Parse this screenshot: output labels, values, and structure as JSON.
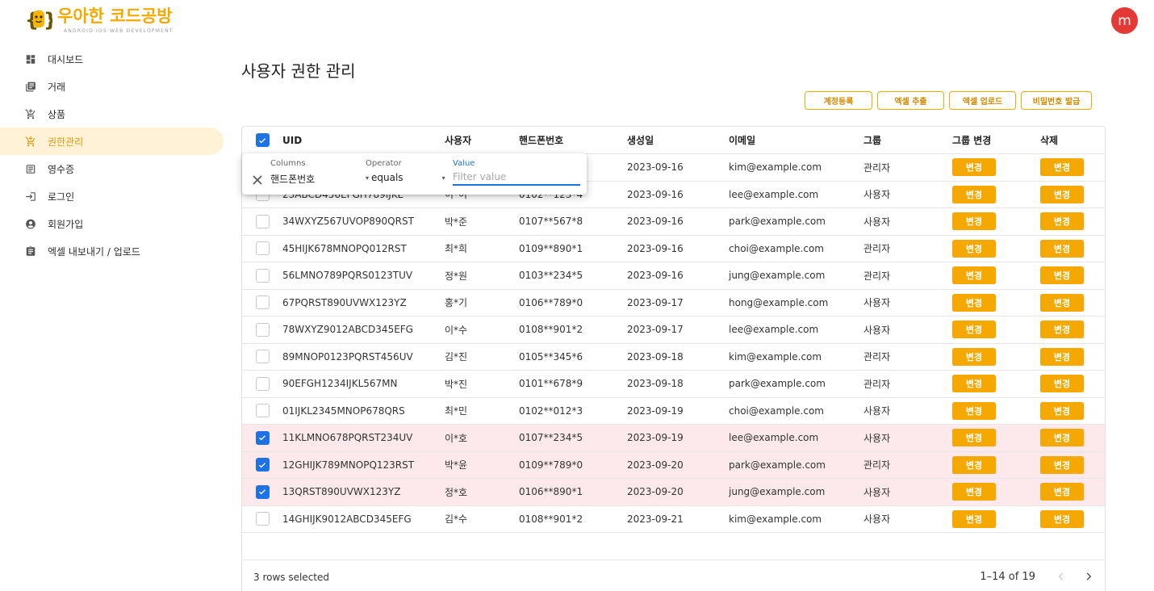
{
  "brand": {
    "title": "우아한 코드공방",
    "subtitle": "ANDROID·IOS·WEB DEVELOPMENT"
  },
  "colors": {
    "accent": "#f5a800",
    "selection": "#1e72e3",
    "selected_row": "#fde9ec",
    "avatar": "#e53935"
  },
  "sidebar": {
    "items": [
      {
        "label": "대시보드",
        "icon": "dashboard-icon"
      },
      {
        "label": "거래",
        "icon": "library-icon"
      },
      {
        "label": "상품",
        "icon": "cart-icon"
      },
      {
        "label": "권한관리",
        "icon": "cart-icon",
        "active": true
      },
      {
        "label": "영수증",
        "icon": "receipt-icon"
      },
      {
        "label": "로그인",
        "icon": "login-icon"
      },
      {
        "label": "회원가입",
        "icon": "account-circle-icon"
      },
      {
        "label": "엑셀 내보내기 / 업로드",
        "icon": "assignment-icon"
      }
    ]
  },
  "user": {
    "avatar_letter": "m"
  },
  "main": {
    "title": "사용자 권한 관리",
    "toolbar": {
      "register": "계정등록",
      "export": "엑셀 추출",
      "upload": "엑셀 업로드",
      "password": "비밀번호 발급"
    }
  },
  "table": {
    "columns": {
      "uid": "UID",
      "user": "사용자",
      "phone": "핸드폰번호",
      "date": "생성일",
      "email": "이메일",
      "group": "그룹",
      "group_change": "그룹 변경",
      "delete": "삭제"
    },
    "button_label": "변경",
    "rows": [
      {
        "uid": "",
        "user": "",
        "phone": "",
        "date": "2023-09-16",
        "email": "kim@example.com",
        "group": "관리자",
        "selected": false
      },
      {
        "uid": "23ABCD456EFGH789IJKL",
        "user": "이*이",
        "phone": "0102**123*4",
        "date": "2023-09-16",
        "email": "lee@example.com",
        "group": "사용자",
        "selected": false
      },
      {
        "uid": "34WXYZ567UVOP890QRST",
        "user": "박*준",
        "phone": "0107**567*8",
        "date": "2023-09-16",
        "email": "park@example.com",
        "group": "사용자",
        "selected": false
      },
      {
        "uid": "45HIJK678MNOPQ012RST",
        "user": "최*희",
        "phone": "0109**890*1",
        "date": "2023-09-16",
        "email": "choi@example.com",
        "group": "관리자",
        "selected": false
      },
      {
        "uid": "56LMNO789PQRS0123TUV",
        "user": "정*원",
        "phone": "0103**234*5",
        "date": "2023-09-16",
        "email": "jung@example.com",
        "group": "관리자",
        "selected": false
      },
      {
        "uid": "67PQRST890UVWX123YZ",
        "user": "홍*기",
        "phone": "0106**789*0",
        "date": "2023-09-17",
        "email": "hong@example.com",
        "group": "사용자",
        "selected": false
      },
      {
        "uid": "78WXYZ9012ABCD345EFG",
        "user": "이*수",
        "phone": "0108**901*2",
        "date": "2023-09-17",
        "email": "lee@example.com",
        "group": "사용자",
        "selected": false
      },
      {
        "uid": "89MNOP0123PQRST456UV",
        "user": "김*진",
        "phone": "0105**345*6",
        "date": "2023-09-18",
        "email": "kim@example.com",
        "group": "관리자",
        "selected": false
      },
      {
        "uid": "90EFGH1234IJKL567MN",
        "user": "박*진",
        "phone": "0101**678*9",
        "date": "2023-09-18",
        "email": "park@example.com",
        "group": "관리자",
        "selected": false
      },
      {
        "uid": "01IJKL2345MNOP678QRS",
        "user": "최*민",
        "phone": "0102**012*3",
        "date": "2023-09-19",
        "email": "choi@example.com",
        "group": "사용자",
        "selected": false
      },
      {
        "uid": "11KLMNO678PQRST234UV",
        "user": "이*호",
        "phone": "0107**234*5",
        "date": "2023-09-19",
        "email": "lee@example.com",
        "group": "사용자",
        "selected": true
      },
      {
        "uid": "12GHIJK789MNOPQ123RST",
        "user": "박*윤",
        "phone": "0109**789*0",
        "date": "2023-09-20",
        "email": "park@example.com",
        "group": "관리자",
        "selected": true
      },
      {
        "uid": "13QRST890UVWX123YZ",
        "user": "정*호",
        "phone": "0106**890*1",
        "date": "2023-09-20",
        "email": "jung@example.com",
        "group": "사용자",
        "selected": true
      },
      {
        "uid": "14GHIJK9012ABCD345EFG",
        "user": "김*수",
        "phone": "0108**901*2",
        "date": "2023-09-21",
        "email": "kim@example.com",
        "group": "사용자",
        "selected": false
      }
    ],
    "footer": {
      "selected_text": "3 rows selected",
      "pagination": "1–14 of 19"
    }
  },
  "filter": {
    "columns_label": "Columns",
    "columns_value": "핸드폰번호",
    "operator_label": "Operator",
    "operator_value": "equals",
    "value_label": "Value",
    "value_placeholder": "Filter value"
  }
}
